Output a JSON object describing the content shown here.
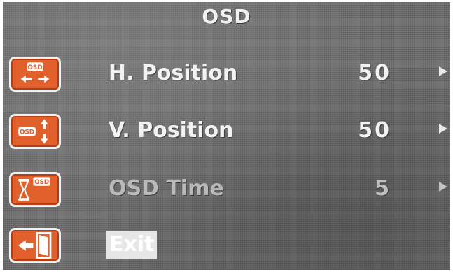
{
  "title": "OSD",
  "menu": [
    {
      "label": "H. Position",
      "value": "50",
      "icon": "osd-horizontal-arrows-icon"
    },
    {
      "label": "V. Position",
      "value": "50",
      "icon": "osd-vertical-arrows-icon"
    },
    {
      "label": "OSD Time",
      "value": "5",
      "icon": "osd-hourglass-icon"
    },
    {
      "label": "Exit",
      "icon": "exit-door-icon"
    }
  ],
  "icon_badge_text": "OSD",
  "colors": {
    "icon_orange": "#e2602c",
    "text": "#f2f2f2",
    "background": "#707070"
  }
}
